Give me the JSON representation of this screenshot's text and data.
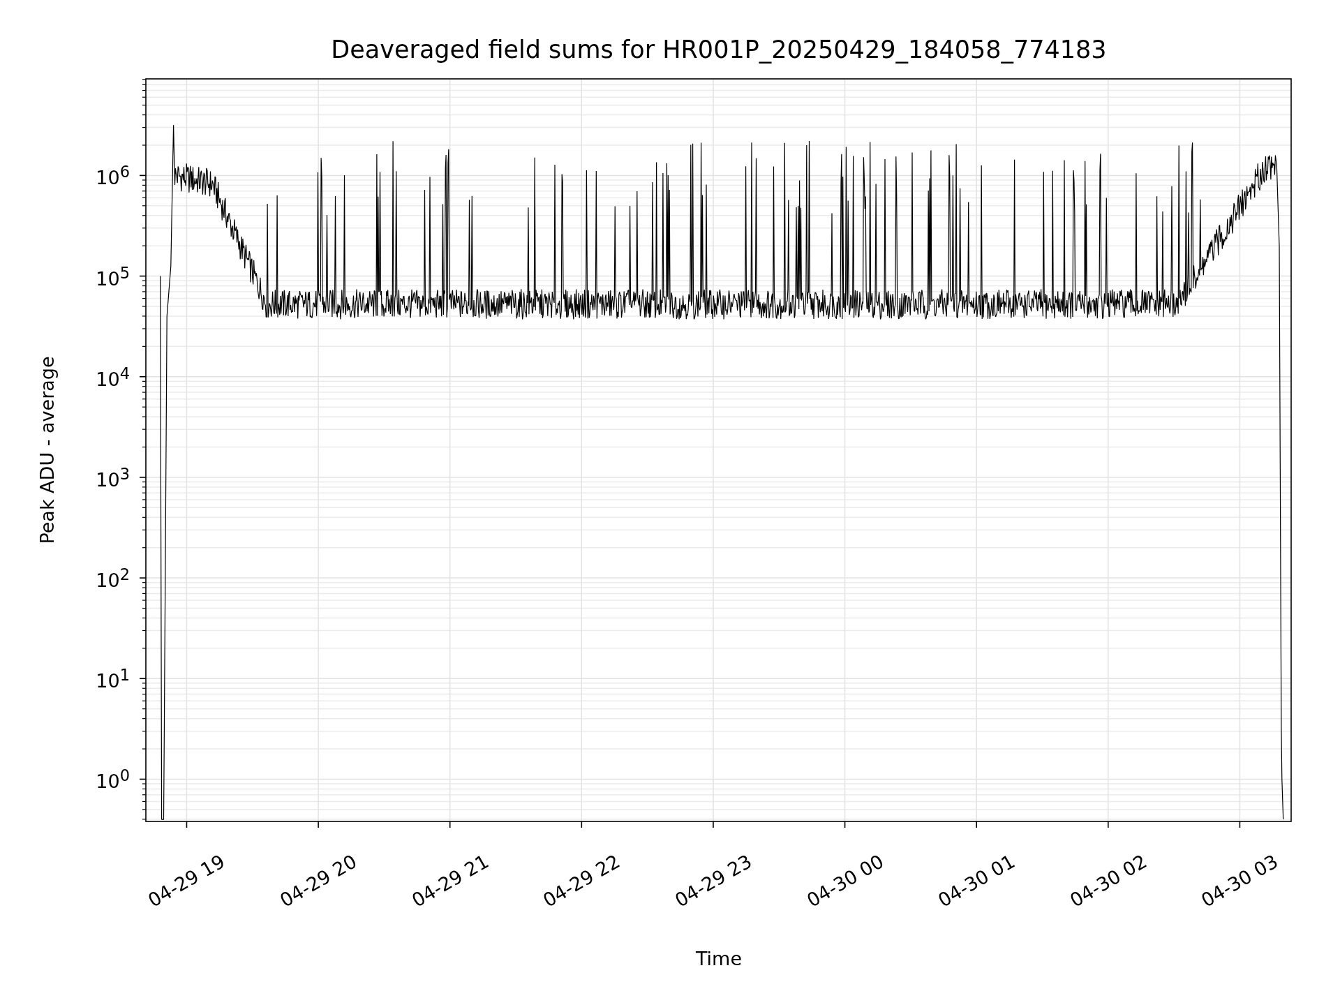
{
  "plot": {
    "title": "Deaveraged field sums for HR001P_20250429_184058_774183",
    "y_axis_label": "Peak ADU - average",
    "x_axis_label": "Time",
    "y_tick_labels": [
      "10$^{6}$",
      "10$^{5}$",
      "10$^{4}$",
      "10$^{3}$",
      "10$^{2}$",
      "10$^{1}$",
      "10$^{0}$"
    ],
    "x_tick_labels": [
      "04-29 19",
      "04-29 20",
      "04-29 21",
      "04-29 22",
      "04-29 23",
      "04-30 00",
      "04-30 01",
      "04-30 02",
      "04-30 03"
    ]
  }
}
